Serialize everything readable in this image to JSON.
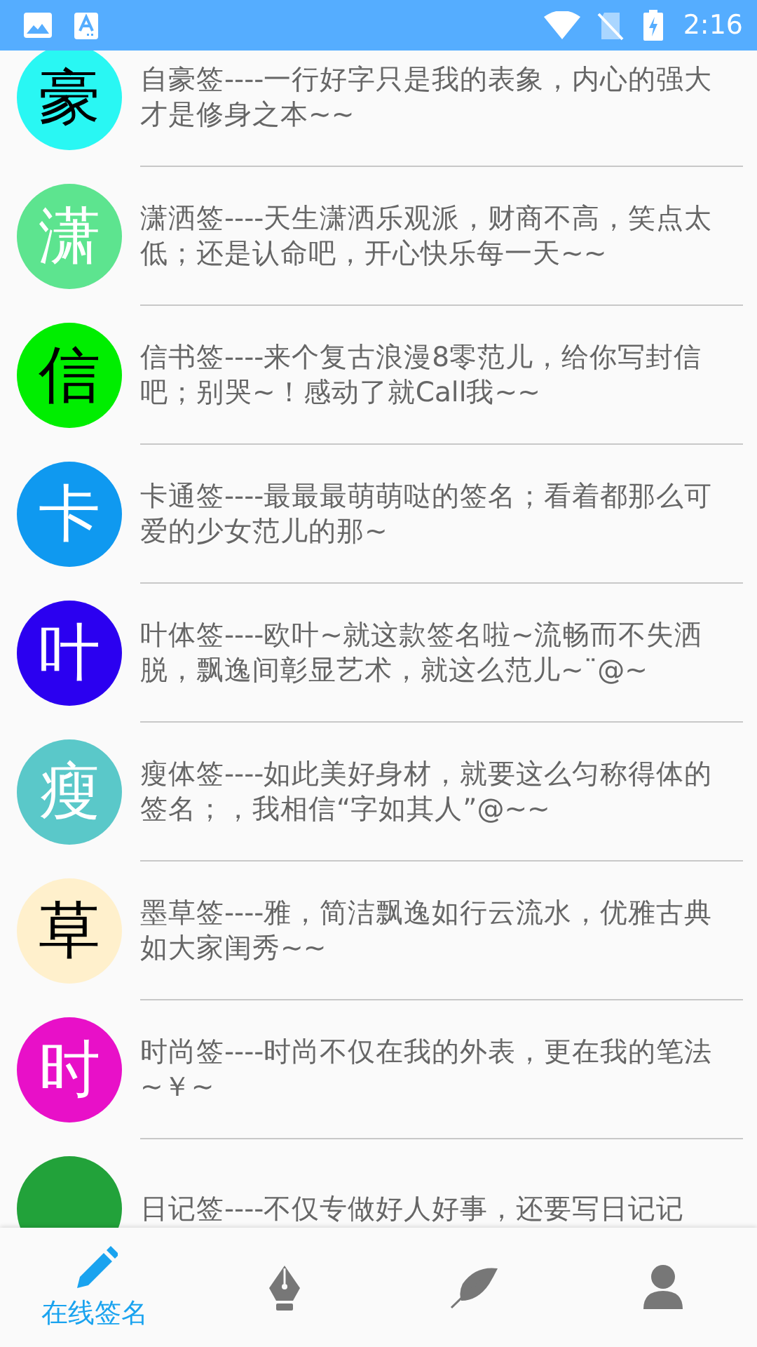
{
  "status_bar": {
    "time": "2:16"
  },
  "signatures": [
    {
      "avatar_char": "豪",
      "color": "#29f7f3",
      "kind": "dark",
      "text": "自豪签----一行好字只是我的表象，内心的强大才是修身之本~~"
    },
    {
      "avatar_char": "潇",
      "color": "#5de48f",
      "kind": "light",
      "text": "潇洒签----天生潇洒乐观派，财商不高，笑点太低；还是认命吧，开心快乐每一天~~"
    },
    {
      "avatar_char": "信",
      "color": "#00ee00",
      "kind": "dark",
      "text": "信书签----来个复古浪漫8零范儿，给你写封信吧；别哭~！感动了就Call我~~"
    },
    {
      "avatar_char": "卡",
      "color": "#0f99f0",
      "kind": "light",
      "text": "卡通签----最最最萌萌哒的签名；看着都那么可爱的少女范儿的那~"
    },
    {
      "avatar_char": "叶",
      "color": "#2b00f0",
      "kind": "light",
      "text": "叶体签----欧叶~就这款签名啦~流畅而不失洒脱，飘逸间彰显艺术，就这么范儿~¨@~"
    },
    {
      "avatar_char": "瘦",
      "color": "#5ac8c9",
      "kind": "light",
      "text": "瘦体签----如此美好身材，就要这么匀称得体的签名；，我相信“字如其人”@~~"
    },
    {
      "avatar_char": "草",
      "color": "#fff0cc",
      "kind": "dark",
      "text": "墨草签----雅，简洁飘逸如行云流水，优雅古典如大家闺秀~~"
    },
    {
      "avatar_char": "时",
      "color": "#e810c8",
      "kind": "light",
      "text": "时尚签----时尚不仅在我的外表，更在我的笔法~￥~"
    },
    {
      "color": "#22a23a",
      "kind": "light",
      "text": "日记签----不仅专做好人好事，还要写日记记"
    }
  ],
  "bottom_nav": [
    {
      "kind": "pencil",
      "label": "在线签名",
      "selected": true
    },
    {
      "kind": "pen-nib",
      "selected": false
    },
    {
      "kind": "feather",
      "selected": false
    },
    {
      "kind": "person",
      "selected": false
    }
  ]
}
